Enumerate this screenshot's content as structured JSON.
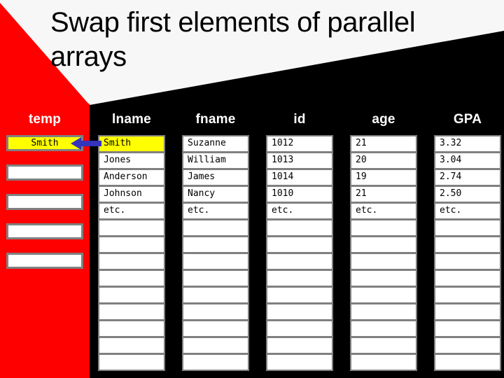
{
  "slide": {
    "title": "Swap first elements of parallel arrays",
    "background_white": "#F7F7F7",
    "background_black": "#000000",
    "accent_red": "#FF0000",
    "highlight_yellow": "#FFFF00",
    "arrow_color": "#3333BB",
    "cell_border": "#808080"
  },
  "temp_column": {
    "header": "temp",
    "cells": [
      "Smith",
      "",
      "",
      "",
      ""
    ],
    "highlighted_index": 0
  },
  "table": {
    "columns": [
      {
        "key": "lname",
        "header": "lname",
        "values": [
          "Smith",
          "Jones",
          "Anderson",
          "Johnson",
          "etc."
        ],
        "highlighted_index": 0
      },
      {
        "key": "fname",
        "header": "fname",
        "values": [
          "Suzanne",
          "William",
          "James",
          "Nancy",
          "etc."
        ],
        "highlighted_index": null
      },
      {
        "key": "id",
        "header": "id",
        "values": [
          "1012",
          "1013",
          "1014",
          "1010",
          "etc."
        ],
        "highlighted_index": null
      },
      {
        "key": "age",
        "header": "age",
        "values": [
          "21",
          "20",
          "19",
          "21",
          "etc."
        ],
        "highlighted_index": null
      },
      {
        "key": "gpa",
        "header": "GPA",
        "values": [
          "3.32",
          "3.04",
          "2.74",
          "2.50",
          "etc."
        ],
        "highlighted_index": null
      }
    ],
    "total_rows": 14
  },
  "arrow": {
    "name": "swap-arrow",
    "direction": "left"
  }
}
